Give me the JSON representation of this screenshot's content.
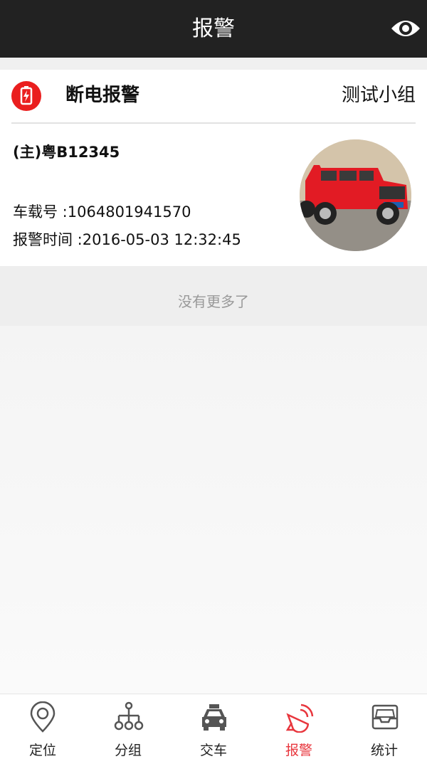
{
  "app_bar": {
    "title": "报警",
    "right_icon": "eye-icon"
  },
  "alarm_card": {
    "icon": "battery-alarm-icon",
    "alarm_type": "断电报警",
    "group": "测试小组",
    "plate": "(主)粤B12345",
    "car_no_label": "车载号 :",
    "car_no_value": "1064801941570",
    "alarm_time_label": "报警时间 :",
    "alarm_time_value": "2016-05-03 12:32:45",
    "vehicle_image": "red-jeep-photo"
  },
  "list_footer": "没有更多了",
  "tabbar": {
    "tabs": [
      {
        "label": "定位",
        "icon": "location-pin-icon"
      },
      {
        "label": "分组",
        "icon": "hierarchy-icon"
      },
      {
        "label": "交车",
        "icon": "taxi-icon"
      },
      {
        "label": "报警",
        "icon": "siren-icon",
        "active": true
      },
      {
        "label": "统计",
        "icon": "tray-icon"
      }
    ]
  },
  "colors": {
    "accent": "#e8363d",
    "header_bg": "#222222",
    "alarm_red": "#ea1f1f"
  }
}
